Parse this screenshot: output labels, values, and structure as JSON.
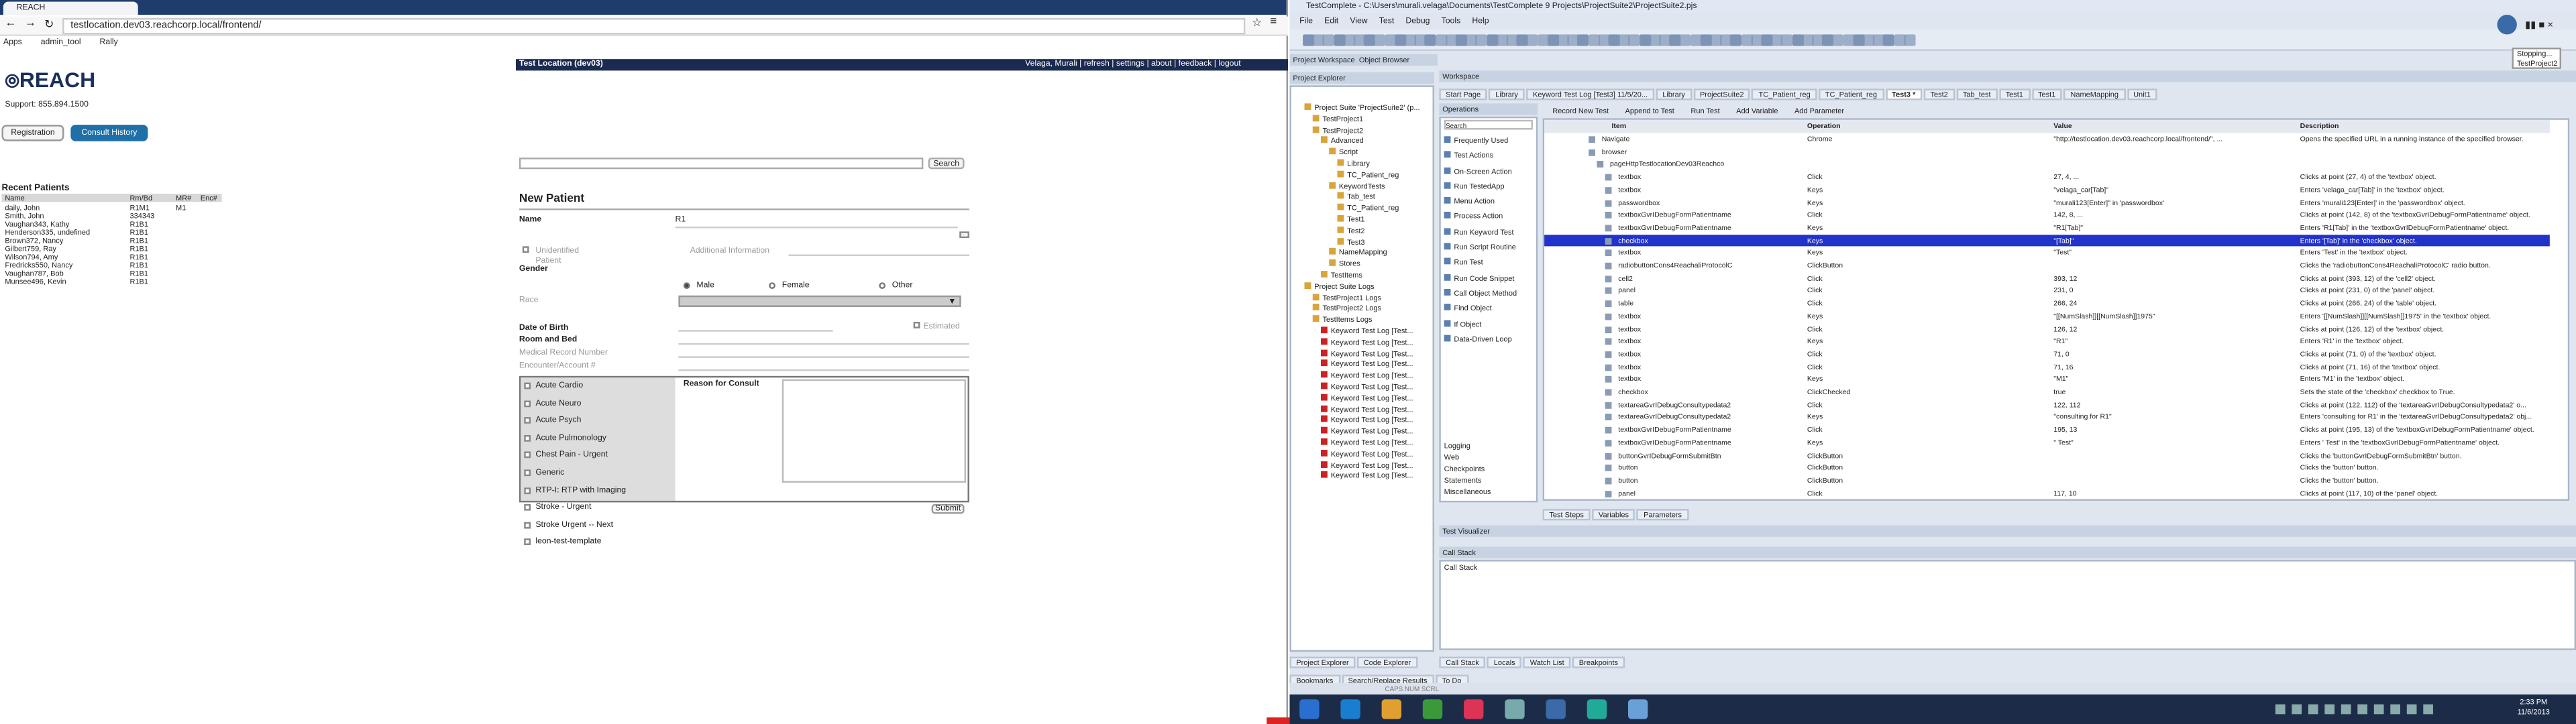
{
  "browser": {
    "tab_title": "REACH",
    "url": "testlocation.dev03.reachcorp.local/frontend/",
    "bookmarks": [
      "Apps",
      "admin_tool",
      "Rally"
    ],
    "location": "Test Location (dev03)",
    "user_links": "Velaga, Murali | refresh | settings | about | feedback | logout",
    "logo": "REACH",
    "support": "Support: 855.894.1500",
    "btn_registration": "Registration",
    "btn_consult": "Consult History",
    "recent_title": "Recent Patients",
    "recent_headers": [
      "Name",
      "Rm/Bd",
      "MR#",
      "Enc#"
    ],
    "recent_rows": [
      [
        "daily, John",
        "R1M1",
        "M1",
        ""
      ],
      [
        "Smith, John",
        "334343",
        "",
        ""
      ],
      [
        "Vaughan343, Kathy",
        "R1B1",
        "",
        ""
      ],
      [
        "Henderson335, undefined",
        "R1B1",
        "",
        ""
      ],
      [
        "Brown372, Nancy",
        "R1B1",
        "",
        ""
      ],
      [
        "Gilbert759, Ray",
        "R1B1",
        "",
        ""
      ],
      [
        "Wilson794, Amy",
        "R1B1",
        "",
        ""
      ],
      [
        "Fredricks550, Nancy",
        "R1B1",
        "",
        ""
      ],
      [
        "Vaughan787, Bob",
        "R1B1",
        "",
        ""
      ],
      [
        "Munsee496, Kevin",
        "R1B1",
        "",
        ""
      ]
    ],
    "search_btn": "Search",
    "form": {
      "title": "New Patient",
      "name_label": "Name",
      "name_value": "R1",
      "unidentified": "Unidentified Patient",
      "additional": "Additional Information",
      "gender_label": "Gender",
      "gender_options": [
        "Male",
        "Female",
        "Other"
      ],
      "race_label": "Race",
      "dob_label": "Date of Birth",
      "estimated": "Estimated",
      "room_label": "Room and Bed",
      "mrn_label": "Medical Record Number",
      "enc_label": "Encounter/Account #",
      "reason_label": "Reason for Consult",
      "reasons": [
        "Acute Cardio",
        "Acute Neuro",
        "Acute Psych",
        "Acute Pulmonology",
        "Chest Pain - Urgent",
        "Generic",
        "RTP-I: RTP with Imaging",
        "Stroke - Urgent",
        "Stroke Urgent -- Next",
        "leon-test-template"
      ],
      "submit": "Submit"
    }
  },
  "tc": {
    "title": "TestComplete - C:\\Users\\murali.velaga\\Documents\\TestComplete 9 Projects\\ProjectSuite2\\ProjectSuite2.pjs",
    "menu": [
      "File",
      "Edit",
      "View",
      "Test",
      "Debug",
      "Tools",
      "Help"
    ],
    "stopping": "Stopping...",
    "stopping_sub": "TestProject2",
    "workspace_tabs": [
      "Project Workspace",
      "Object Browser"
    ],
    "project_explorer": "Project Explorer",
    "tree": [
      "Project Suite 'ProjectSuite2' (p...",
      "TestProject1",
      "TestProject2",
      "Advanced",
      "Script",
      "Library",
      "TC_Patient_reg",
      "KeywordTests",
      "Tab_test",
      "TC_Patient_reg",
      "Test1",
      "Test2",
      "Test3",
      "NameMapping",
      "Stores",
      "TestItems",
      "Project Suite Logs",
      "TestProject1 Logs",
      "TestProject2 Logs",
      "TestItems Logs",
      "Keyword Test Log [Test...",
      "Keyword Test Log [Test...",
      "Keyword Test Log [Test...",
      "Keyword Test Log [Test...",
      "Keyword Test Log [Test...",
      "Keyword Test Log [Test...",
      "Keyword Test Log [Test...",
      "Keyword Test Log [Test...",
      "Keyword Test Log [Test...",
      "Keyword Test Log [Test...",
      "Keyword Test Log [Test...",
      "Keyword Test Log [Test...",
      "Keyword Test Log [Test...",
      "Keyword Test Log [Test..."
    ],
    "workspace_label": "Workspace",
    "editor_tabs": [
      "Start Page",
      "Library",
      "Keyword Test Log [Test3] 11/5/20...",
      "Library",
      "ProjectSuite2",
      "TC_Patient_reg",
      "TC_Patient_reg",
      "Test3 *",
      "Test2",
      "Tab_test",
      "Test1",
      "Test1",
      "NameMapping",
      "Unit1"
    ],
    "operations_label": "Operations",
    "ops_search": "Search",
    "ops": [
      "Frequently Used",
      "Test Actions",
      "On-Screen Action",
      "Run TestedApp",
      "Menu Action",
      "Process Action",
      "Run Keyword Test",
      "Run Script Routine",
      "Run Test",
      "Run Code Snippet",
      "Call Object Method",
      "Find Object",
      "If Object",
      "Data-Driven Loop"
    ],
    "ops_bottom": [
      "Logging",
      "Web",
      "Checkpoints",
      "Statements",
      "Miscellaneous"
    ],
    "kt_toolbar": [
      "Record New Test",
      "Append to Test",
      "Run Test",
      "Add Variable",
      "Add Parameter"
    ],
    "grid_headers": [
      "Item",
      "Operation",
      "Value",
      "Description"
    ],
    "grid": [
      [
        "Navigate",
        "Chrome",
        "\"http://testlocation.dev03.reachcorp.local/frontend/\", ...",
        "Opens the specified URL in a running instance of the specified browser."
      ],
      [
        "browser",
        "",
        "",
        ""
      ],
      [
        "pageHttpTestlocationDev03Reachco",
        "",
        "",
        ""
      ],
      [
        "textbox",
        "Click",
        "27, 4, ...",
        "Clicks at point (27, 4) of the 'textbox' object."
      ],
      [
        "textbox",
        "Keys",
        "\"velaga_car[Tab]\"",
        "Enters 'velaga_car[Tab]' in the 'textbox' object."
      ],
      [
        "passwordbox",
        "Keys",
        "\"murali123[Enter]\" in 'passwordbox'",
        "Enters 'murali123[Enter]' in the 'passwordbox' object."
      ],
      [
        "textboxGvrIDebugFormPatientname",
        "Click",
        "142, 8, ...",
        "Clicks at point (142, 8) of the 'textboxGvrIDebugFormPatientname' object."
      ],
      [
        "textboxGvrIDebugFormPatientname",
        "Keys",
        "\"R1[Tab]\"",
        "Enters 'R1[Tab]' in the 'textboxGvrIDebugFormPatientname' object."
      ],
      [
        "checkbox",
        "Keys",
        "\"[Tab]\"",
        "Enters '[Tab]' in the 'checkbox' object."
      ],
      [
        "textbox",
        "Keys",
        "\"Test\"",
        "Enters 'Test' in the 'textbox' object."
      ],
      [
        "radiobuttonCons4ReachaliProtocolC",
        "ClickButton",
        "",
        "Clicks the 'radiobuttonCons4ReachaliProtocolC' radio button."
      ],
      [
        "cell2",
        "Click",
        "393, 12",
        "Clicks at point (393, 12) of the 'cell2' object."
      ],
      [
        "panel",
        "Click",
        "231, 0",
        "Clicks at point (231, 0) of the 'panel' object."
      ],
      [
        "table",
        "Click",
        "266, 24",
        "Clicks at point (266, 24) of the 'table' object."
      ],
      [
        "textbox",
        "Keys",
        "\"[[NumSlash]][[NumSlash]]1975\"",
        "Enters '[[NumSlash]][[NumSlash]]1975' in the 'textbox' object."
      ],
      [
        "textbox",
        "Click",
        "126, 12",
        "Clicks at point (126, 12) of the 'textbox' object."
      ],
      [
        "textbox",
        "Keys",
        "\"R1\"",
        "Enters 'R1' in the 'textbox' object."
      ],
      [
        "textbox",
        "Click",
        "71, 0",
        "Clicks at point (71, 0) of the 'textbox' object."
      ],
      [
        "textbox",
        "Click",
        "71, 16",
        "Clicks at point (71, 16) of the 'textbox' object."
      ],
      [
        "textbox",
        "Keys",
        "\"M1\"",
        "Enters 'M1' in the 'textbox' object."
      ],
      [
        "checkbox",
        "ClickChecked",
        "true",
        "Sets the state of the 'checkbox' checkbox to True."
      ],
      [
        "textareaGvrIDebugConsultypedata2",
        "Click",
        "122, 112",
        "Clicks at point (122, 112) of the 'textareaGvrIDebugConsultypedata2' o..."
      ],
      [
        "textareaGvrIDebugConsultypedata2",
        "Keys",
        "\"consulting for R1\"",
        "Enters 'consulting for R1' in the 'textareaGvrIDebugConsultypedata2' obj..."
      ],
      [
        "textboxGvrIDebugFormPatientname",
        "Click",
        "195, 13",
        "Clicks at point (195, 13) of the 'textboxGvrIDebugFormPatientname' object."
      ],
      [
        "textboxGvrIDebugFormPatientname",
        "Keys",
        "\" Test\"",
        "Enters ' Test' in the 'textboxGvrIDebugFormPatientname' object."
      ],
      [
        "buttonGvrIDebugFormSubmitBtn",
        "ClickButton",
        "",
        "Clicks the 'buttonGvrIDebugFormSubmitBtn' button."
      ],
      [
        "button",
        "ClickButton",
        "",
        "Clicks the 'button' button."
      ],
      [
        "button",
        "ClickButton",
        "",
        "Clicks the 'button' button."
      ],
      [
        "panel",
        "Click",
        "117, 10",
        "Clicks at point (117, 10) of the 'panel' object."
      ]
    ],
    "selected_row": 8,
    "bottom_tabs": [
      "Test Steps",
      "Variables",
      "Parameters"
    ],
    "test_visualizer": "Test Visualizer",
    "call_stack": "Call Stack",
    "call_stack2": "Call Stack",
    "debug_tabs": [
      "Call Stack",
      "Locals",
      "Watch List",
      "Breakpoints"
    ],
    "left_bottom_tabs": [
      "Project Explorer",
      "Code Explorer"
    ],
    "left_bottom_tabs2": [
      "Bookmarks",
      "Search/Replace Results",
      "To Do"
    ],
    "status": "CAPS   NUM   SCRL",
    "time": "2:33 PM",
    "date": "11/6/2013"
  },
  "colors": {
    "accent": "#1f6fa8",
    "brand": "#1a2f5e",
    "selection": "#2233cc"
  }
}
